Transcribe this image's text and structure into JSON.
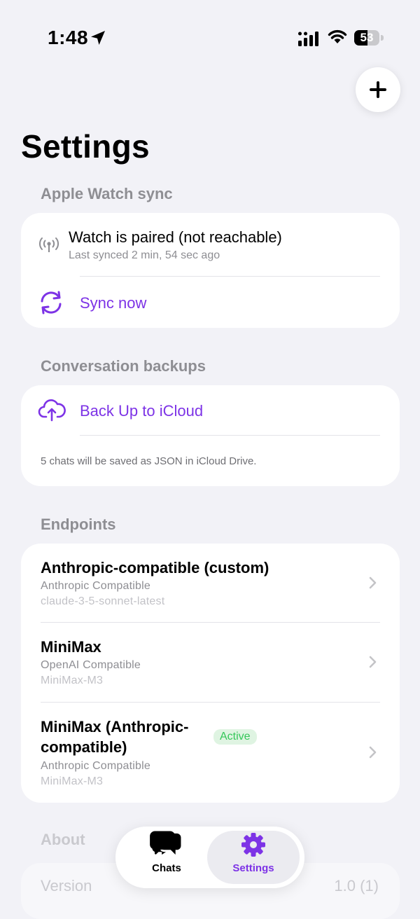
{
  "status_bar": {
    "time": "1:48",
    "battery": "53",
    "battery_level": 0.53
  },
  "page": {
    "title": "Settings"
  },
  "colors": {
    "accent": "#7d33e6",
    "active_green": "#34c759",
    "background": "#f2f2f7"
  },
  "watch_sync": {
    "header": "Apple Watch sync",
    "status_title": "Watch is paired (not reachable)",
    "status_sub": "Last synced 2 min, 54 sec ago",
    "status_icon": "antenna-icon",
    "sync_label": "Sync now",
    "sync_icon": "sync-arrows-icon"
  },
  "backups": {
    "header": "Conversation backups",
    "backup_label": "Back Up to iCloud",
    "backup_icon": "cloud-upload-icon",
    "note": "5 chats will be saved as JSON in iCloud Drive."
  },
  "endpoints": {
    "header": "Endpoints",
    "items": [
      {
        "title": "Anthropic-compatible (custom)",
        "type": "Anthropic Compatible",
        "model": "claude-3-5-sonnet-latest"
      },
      {
        "title": "MiniMax",
        "type": "OpenAI Compatible",
        "model": "MiniMax-M3"
      },
      {
        "title": "MiniMax (Anthropic-compatible)",
        "title_line1": "MiniMax (Anthropic-",
        "title_line2": "compatible)",
        "type": "Anthropic Compatible",
        "model": "MiniMax-M3",
        "badge": "Active"
      }
    ]
  },
  "about": {
    "header": "About",
    "version_label": "Version",
    "version_value": "1.0 (1)"
  },
  "tabbar": {
    "tabs": [
      {
        "label": "Chats",
        "icon": "chat-bubbles-icon",
        "selected": false
      },
      {
        "label": "Settings",
        "icon": "gear-icon",
        "selected": true
      }
    ]
  }
}
